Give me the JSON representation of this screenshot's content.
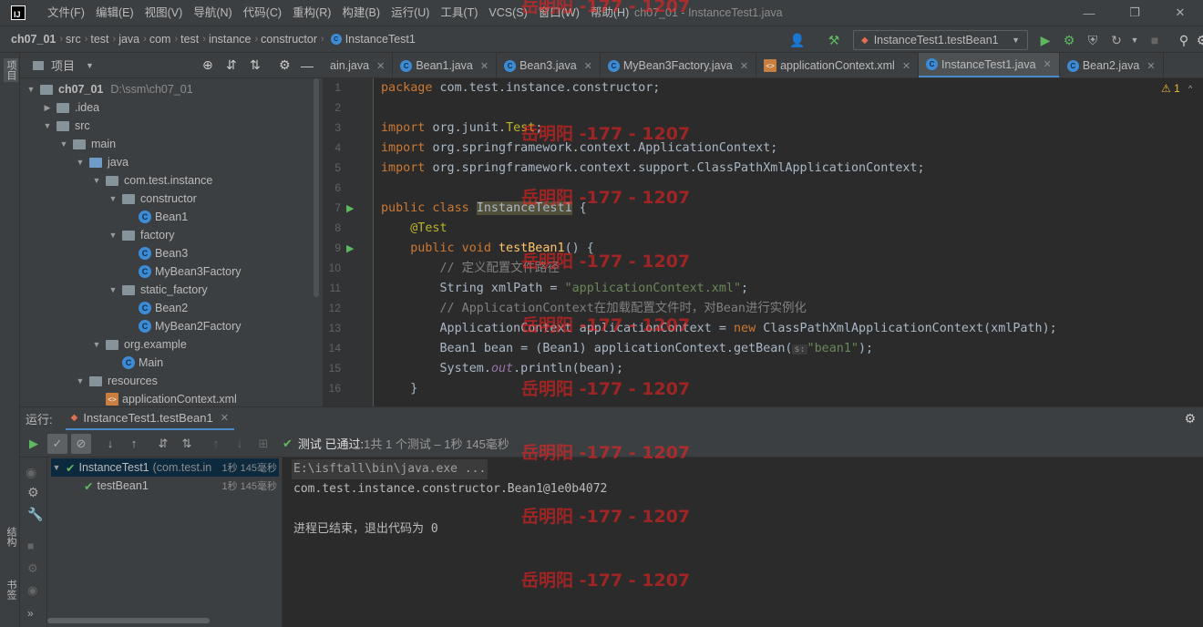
{
  "titlebar": {
    "app_icon": "IJ",
    "menus": [
      "文件(F)",
      "编辑(E)",
      "视图(V)",
      "导航(N)",
      "代码(C)",
      "重构(R)",
      "构建(B)",
      "运行(U)",
      "工具(T)",
      "VCS(S)",
      "窗口(W)",
      "帮助(H)"
    ],
    "title": "ch07_01 - InstanceTest1.java"
  },
  "navbar": {
    "crumbs": [
      "ch07_01",
      "src",
      "test",
      "java",
      "com",
      "test",
      "instance",
      "constructor"
    ],
    "file": "InstanceTest1",
    "run_config": "InstanceTest1.testBean1"
  },
  "left_strip": {
    "project": "项目",
    "structure": "结构",
    "bookmarks": "书签"
  },
  "project": {
    "title": "项目",
    "tree": [
      {
        "label": "ch07_01",
        "extra": "D:\\ssm\\ch07_01",
        "kind": "module",
        "depth": 0,
        "arrow": "down"
      },
      {
        "label": ".idea",
        "kind": "folder",
        "depth": 1,
        "arrow": "right"
      },
      {
        "label": "src",
        "kind": "folder",
        "depth": 1,
        "arrow": "down"
      },
      {
        "label": "main",
        "kind": "folder",
        "depth": 2,
        "arrow": "down"
      },
      {
        "label": "java",
        "kind": "source",
        "depth": 3,
        "arrow": "down"
      },
      {
        "label": "com.test.instance",
        "kind": "package",
        "depth": 4,
        "arrow": "down"
      },
      {
        "label": "constructor",
        "kind": "package",
        "depth": 5,
        "arrow": "down"
      },
      {
        "label": "Bean1",
        "kind": "class",
        "depth": 6,
        "arrow": ""
      },
      {
        "label": "factory",
        "kind": "package",
        "depth": 5,
        "arrow": "down"
      },
      {
        "label": "Bean3",
        "kind": "class",
        "depth": 6,
        "arrow": ""
      },
      {
        "label": "MyBean3Factory",
        "kind": "class",
        "depth": 6,
        "arrow": ""
      },
      {
        "label": "static_factory",
        "kind": "package",
        "depth": 5,
        "arrow": "down"
      },
      {
        "label": "Bean2",
        "kind": "class",
        "depth": 6,
        "arrow": ""
      },
      {
        "label": "MyBean2Factory",
        "kind": "class",
        "depth": 6,
        "arrow": ""
      },
      {
        "label": "org.example",
        "kind": "package",
        "depth": 4,
        "arrow": "down"
      },
      {
        "label": "Main",
        "kind": "class",
        "depth": 5,
        "arrow": ""
      },
      {
        "label": "resources",
        "kind": "resources",
        "depth": 3,
        "arrow": "down"
      },
      {
        "label": "applicationContext.xml",
        "kind": "xml",
        "depth": 4,
        "arrow": ""
      }
    ]
  },
  "tabs": [
    {
      "label": "ain.java",
      "icon": "none",
      "active": false
    },
    {
      "label": "Bean1.java",
      "icon": "class",
      "active": false
    },
    {
      "label": "Bean3.java",
      "icon": "class",
      "active": false
    },
    {
      "label": "MyBean3Factory.java",
      "icon": "class",
      "active": false
    },
    {
      "label": "applicationContext.xml",
      "icon": "xml",
      "active": false
    },
    {
      "label": "InstanceTest1.java",
      "icon": "test",
      "active": true
    },
    {
      "label": "Bean2.java",
      "icon": "class",
      "active": false
    }
  ],
  "editor": {
    "warnings": "1",
    "line_numbers": [
      "1",
      "2",
      "3",
      "4",
      "5",
      "6",
      "7",
      "8",
      "9",
      "10",
      "11",
      "12",
      "13",
      "14",
      "15",
      "16"
    ],
    "lines": [
      [
        [
          "kw",
          "package "
        ],
        [
          "",
          "com.test.instance.constructor;"
        ]
      ],
      [],
      [
        [
          "kw",
          "import "
        ],
        [
          "",
          "org.junit."
        ],
        [
          "ann",
          "Test"
        ],
        [
          "",
          "; "
        ]
      ],
      [
        [
          "kw",
          "import "
        ],
        [
          "",
          "org.springframework.context.ApplicationContext;"
        ]
      ],
      [
        [
          "kw",
          "import "
        ],
        [
          "",
          "org.springframework.context.support.ClassPathXmlApplicationContext;"
        ]
      ],
      [],
      [
        [
          "kw",
          "public class "
        ],
        [
          "hl",
          "InstanceTest1"
        ],
        [
          "",
          " {"
        ]
      ],
      [
        [
          "",
          "    "
        ],
        [
          "ann",
          "@Test"
        ]
      ],
      [
        [
          "",
          "    "
        ],
        [
          "kw",
          "public void "
        ],
        [
          "fn",
          "testBean1"
        ],
        [
          "",
          "() {"
        ]
      ],
      [
        [
          "",
          "        "
        ],
        [
          "cmt",
          "// 定义配置文件路径"
        ]
      ],
      [
        [
          "",
          "        String xmlPath = "
        ],
        [
          "str",
          "\"applicationContext.xml\""
        ],
        [
          "",
          ";"
        ]
      ],
      [
        [
          "",
          "        "
        ],
        [
          "cmt",
          "// ApplicationContext在加载配置文件时，对Bean进行实例化"
        ]
      ],
      [
        [
          "",
          "        ApplicationContext applicationContext = "
        ],
        [
          "kw",
          "new "
        ],
        [
          "",
          "ClassPathXmlApplicationContext(xmlPath);"
        ]
      ],
      [
        [
          "",
          "        Bean1 bean = (Bean1) applicationContext.getBean("
        ],
        [
          "hint",
          "s:"
        ],
        [
          "str",
          "\"bean1\""
        ],
        [
          "",
          ");"
        ]
      ],
      [
        [
          "",
          "        System."
        ],
        [
          "fld",
          "out"
        ],
        [
          "",
          ".println(bean);"
        ]
      ],
      [
        [
          "",
          "    }"
        ]
      ]
    ]
  },
  "watermark": "岳明阳 -177 - 1207",
  "run": {
    "label": "运行:",
    "tab": "InstanceTest1.testBean1",
    "status_label": "测试 已通过:",
    "status_detail": " 1共 1 个测试 – 1秒 145毫秒",
    "tree": [
      {
        "name": "InstanceTest1",
        "pkg": "(com.test.in",
        "time": "1秒 145毫秒"
      },
      {
        "name": "testBean1",
        "pkg": "",
        "time": "1秒 145毫秒"
      }
    ],
    "console": [
      "E:\\isftall\\bin\\java.exe ...",
      "com.test.instance.constructor.Bean1@1e0b4072",
      "",
      "进程已结束，退出代码为 0"
    ]
  },
  "colors": {
    "accent": "#4a88c7",
    "pass": "#5fb85f",
    "watermark": "#ff2020"
  }
}
